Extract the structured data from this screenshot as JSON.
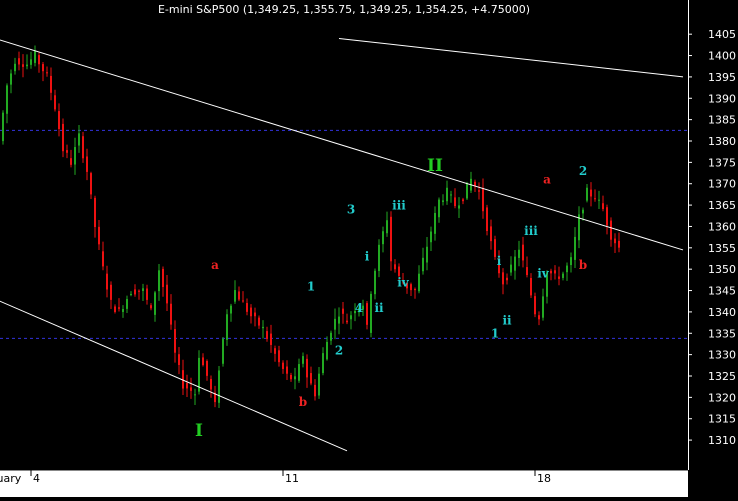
{
  "chart_data": {
    "type": "candlestick",
    "title": "E-mini S&P500 (1,349.25, 1,355.75, 1,349.25, 1,354.25, +4.75000)",
    "ylim": [
      1303,
      1413
    ],
    "y_ticks": [
      1310,
      1315,
      1320,
      1325,
      1330,
      1335,
      1340,
      1345,
      1350,
      1355,
      1360,
      1365,
      1370,
      1375,
      1380,
      1385,
      1390,
      1395,
      1400,
      1405
    ],
    "x_ticks": [
      {
        "label": "ruary",
        "bar": 0
      },
      {
        "label": "4",
        "bar": 7
      },
      {
        "label": "11",
        "bar": 70
      },
      {
        "label": "18",
        "bar": 133
      }
    ],
    "bar_count": 155,
    "colors": {
      "up": "#22aa22",
      "down": "#ee1111",
      "background": "#000000",
      "guide": "#3333dd",
      "trendline": "#ffffff",
      "axis_bg": "#ffffff"
    },
    "path_points": [
      [
        0,
        1380
      ],
      [
        2,
        1393
      ],
      [
        4,
        1399
      ],
      [
        7,
        1398
      ],
      [
        9,
        1400
      ],
      [
        12,
        1395
      ],
      [
        14,
        1388
      ],
      [
        16,
        1378
      ],
      [
        18,
        1375
      ],
      [
        20,
        1381
      ],
      [
        22,
        1373
      ],
      [
        24,
        1360
      ],
      [
        26,
        1350
      ],
      [
        28,
        1342
      ],
      [
        30,
        1340
      ],
      [
        33,
        1345
      ],
      [
        36,
        1345
      ],
      [
        38,
        1340
      ],
      [
        40,
        1350
      ],
      [
        42,
        1342
      ],
      [
        44,
        1330
      ],
      [
        46,
        1323
      ],
      [
        49,
        1321
      ],
      [
        50,
        1330
      ],
      [
        52,
        1325
      ],
      [
        54,
        1318
      ],
      [
        55,
        1327
      ],
      [
        57,
        1340
      ],
      [
        59,
        1345
      ],
      [
        61,
        1342
      ],
      [
        63,
        1339
      ],
      [
        66,
        1336
      ],
      [
        68,
        1332
      ],
      [
        70,
        1328
      ],
      [
        72,
        1325
      ],
      [
        74,
        1324
      ],
      [
        76,
        1330
      ],
      [
        77,
        1325
      ],
      [
        79,
        1321
      ],
      [
        81,
        1330
      ],
      [
        83,
        1336
      ],
      [
        85,
        1340
      ],
      [
        87,
        1338
      ],
      [
        89,
        1341
      ],
      [
        91,
        1342
      ],
      [
        92,
        1336
      ],
      [
        93,
        1345
      ],
      [
        95,
        1355
      ],
      [
        97,
        1362
      ],
      [
        98,
        1352
      ],
      [
        100,
        1348
      ],
      [
        102,
        1346
      ],
      [
        104,
        1345
      ],
      [
        106,
        1352
      ],
      [
        108,
        1359
      ],
      [
        110,
        1366
      ],
      [
        112,
        1368
      ],
      [
        114,
        1365
      ],
      [
        116,
        1367
      ],
      [
        118,
        1371
      ],
      [
        120,
        1368
      ],
      [
        122,
        1360
      ],
      [
        124,
        1352
      ],
      [
        126,
        1347
      ],
      [
        128,
        1350
      ],
      [
        130,
        1355
      ],
      [
        132,
        1348
      ],
      [
        134,
        1340
      ],
      [
        135,
        1339
      ],
      [
        137,
        1350
      ],
      [
        139,
        1348
      ],
      [
        141,
        1349
      ],
      [
        143,
        1352
      ],
      [
        145,
        1362
      ],
      [
        147,
        1368
      ],
      [
        149,
        1367
      ],
      [
        151,
        1364
      ],
      [
        153,
        1358
      ],
      [
        155,
        1355
      ]
    ],
    "series": [
      {
        "type": "trendline",
        "from": {
          "bar": -2,
          "price": 1404
        },
        "to": {
          "bar": 170,
          "price": 1354.5
        }
      },
      {
        "type": "trendline",
        "from": {
          "bar": 84,
          "price": 1404
        },
        "to": {
          "bar": 170,
          "price": 1395
        }
      },
      {
        "type": "trendline",
        "from": {
          "bar": -2,
          "price": 1343
        },
        "to": {
          "bar": 86,
          "price": 1307.5
        }
      },
      {
        "type": "hline",
        "price": 1382.5
      },
      {
        "type": "hline",
        "price": 1333.8
      }
    ],
    "annotations": [
      {
        "text": "II",
        "bar": 108,
        "price": 1373,
        "color": "#22cc22",
        "size": 17
      },
      {
        "text": "I",
        "bar": 49,
        "price": 1311,
        "color": "#22cc22",
        "size": 17
      },
      {
        "text": "a",
        "bar": 53,
        "price": 1350,
        "color": "#ee2222",
        "size": 12
      },
      {
        "text": "b",
        "bar": 75,
        "price": 1318,
        "color": "#ee2222",
        "size": 12
      },
      {
        "text": "a",
        "bar": 136,
        "price": 1370,
        "color": "#ee2222",
        "size": 12
      },
      {
        "text": "b",
        "bar": 145,
        "price": 1350,
        "color": "#ee2222",
        "size": 12
      },
      {
        "text": "1",
        "bar": 77,
        "price": 1345,
        "color": "#22cccc",
        "size": 12
      },
      {
        "text": "2",
        "bar": 84,
        "price": 1330,
        "color": "#22cccc",
        "size": 12
      },
      {
        "text": "3",
        "bar": 87,
        "price": 1363,
        "color": "#22cccc",
        "size": 12
      },
      {
        "text": "4",
        "bar": 89,
        "price": 1340,
        "color": "#22cccc",
        "size": 12
      },
      {
        "text": "i",
        "bar": 91,
        "price": 1352,
        "color": "#22cccc",
        "size": 12
      },
      {
        "text": "ii",
        "bar": 94,
        "price": 1340,
        "color": "#22cccc",
        "size": 12
      },
      {
        "text": "iii",
        "bar": 99,
        "price": 1364,
        "color": "#22cccc",
        "size": 12
      },
      {
        "text": "iv",
        "bar": 100,
        "price": 1346,
        "color": "#22cccc",
        "size": 12
      },
      {
        "text": "i",
        "bar": 124,
        "price": 1351,
        "color": "#22cccc",
        "size": 12
      },
      {
        "text": "ii",
        "bar": 126,
        "price": 1337,
        "color": "#22cccc",
        "size": 12
      },
      {
        "text": "1",
        "bar": 123,
        "price": 1334,
        "color": "#22cccc",
        "size": 12
      },
      {
        "text": "iii",
        "bar": 132,
        "price": 1358,
        "color": "#22cccc",
        "size": 12
      },
      {
        "text": "iv",
        "bar": 135,
        "price": 1348,
        "color": "#22cccc",
        "size": 12
      },
      {
        "text": "2",
        "bar": 145,
        "price": 1372,
        "color": "#22cccc",
        "size": 12
      }
    ]
  }
}
